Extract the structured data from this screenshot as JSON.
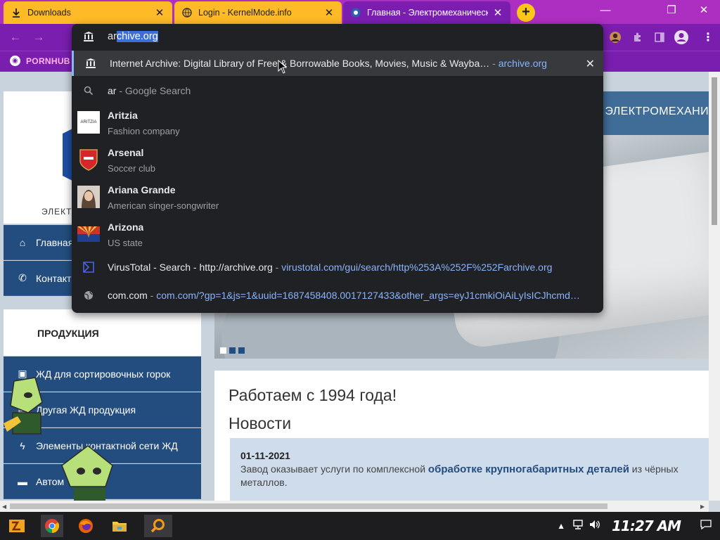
{
  "tabs": [
    {
      "title": "Downloads",
      "icon": "download-icon"
    },
    {
      "title": "Login - KernelMode.info",
      "icon": "globe-icon"
    },
    {
      "title": "Главная - Электромеханическ",
      "icon": "site-favicon"
    }
  ],
  "window_controls": {
    "minimize": "—",
    "restore": "❐",
    "close": "✕"
  },
  "toolbar": {
    "back": "←",
    "forward": "→"
  },
  "bookmarks": [
    {
      "label": "PORNHUB"
    }
  ],
  "omnibox": {
    "typed_prefix": "ar",
    "autocomplete_suffix": "chive.org",
    "suggestions": [
      {
        "title": "Internet Archive: Digital Library of Free & Borrowable Books, Movies, Music & Wayba…",
        "sep": " - ",
        "url": "archive.org",
        "icon": "archive-icon"
      },
      {
        "title": "ar",
        "sep": " - ",
        "suffix": "Google Search",
        "icon": "search-icon"
      },
      {
        "title": "Aritzia",
        "subtitle": "Fashion company",
        "icon": "aritzia-thumb",
        "thumb_text": "ARITZIA"
      },
      {
        "title": "Arsenal",
        "subtitle": "Soccer club",
        "icon": "arsenal-crest"
      },
      {
        "title": "Ariana Grande",
        "subtitle": "American singer-songwriter",
        "icon": "ariana-photo"
      },
      {
        "title": "Arizona",
        "subtitle": "US state",
        "icon": "arizona-flag"
      },
      {
        "title": "VirusTotal - Search - http://archive.org",
        "sep": " - ",
        "url": "virustotal.com/gui/search/http%253A%252F%252Farchive.org",
        "icon": "virustotal-icon"
      },
      {
        "title": "com.com",
        "sep": " - ",
        "url": "com.com/?gp=1&js=1&uuid=1687458408.0017127433&other_args=eyJ1cmkiOiAiLyIsICJhcmd…",
        "icon": "globe-icon"
      }
    ],
    "remove_label": "✕"
  },
  "page": {
    "logo_text": "ЭЛЕКТ",
    "hero_title": "ЭЛЕКТРОМЕХАНИ",
    "nav": [
      {
        "label": "Главная",
        "icon": "home-icon",
        "glyph": "⌂"
      },
      {
        "label": "Контакт",
        "icon": "phone-icon",
        "glyph": "✆"
      }
    ],
    "products_title": "ПРОДУКЦИЯ",
    "products": [
      {
        "label": "ЖД для сортировочных горок",
        "icon": "train-icon",
        "glyph": "▣"
      },
      {
        "label": "Другая ЖД продукция",
        "icon": "rail-icon",
        "glyph": "▤"
      },
      {
        "label": "Элементы контактной сети ЖД",
        "icon": "lightning-icon",
        "glyph": "ϟ"
      },
      {
        "label": "Автом",
        "icon": "car-icon",
        "glyph": "▬"
      }
    ],
    "since": "Работаем с 1994 года!",
    "news_heading": "Новости",
    "news": {
      "date": "01-11-2021",
      "text_before": "Завод оказывает услуги по комплексной ",
      "link": "обработке крупногабаритных деталей",
      "text_after": " из чёрных металлов."
    }
  },
  "taskbar": {
    "time": "11:27 AM",
    "apps": [
      "start-icon",
      "chrome-icon",
      "firefox-icon",
      "explorer-icon",
      "search-app-icon"
    ]
  },
  "colors": {
    "tab_orange": "#ffba28",
    "chrome_purple": "#7a1eb0",
    "omnibox_bg": "#202124",
    "link_blue": "#8ab4f8",
    "site_blue": "#234d7e"
  }
}
